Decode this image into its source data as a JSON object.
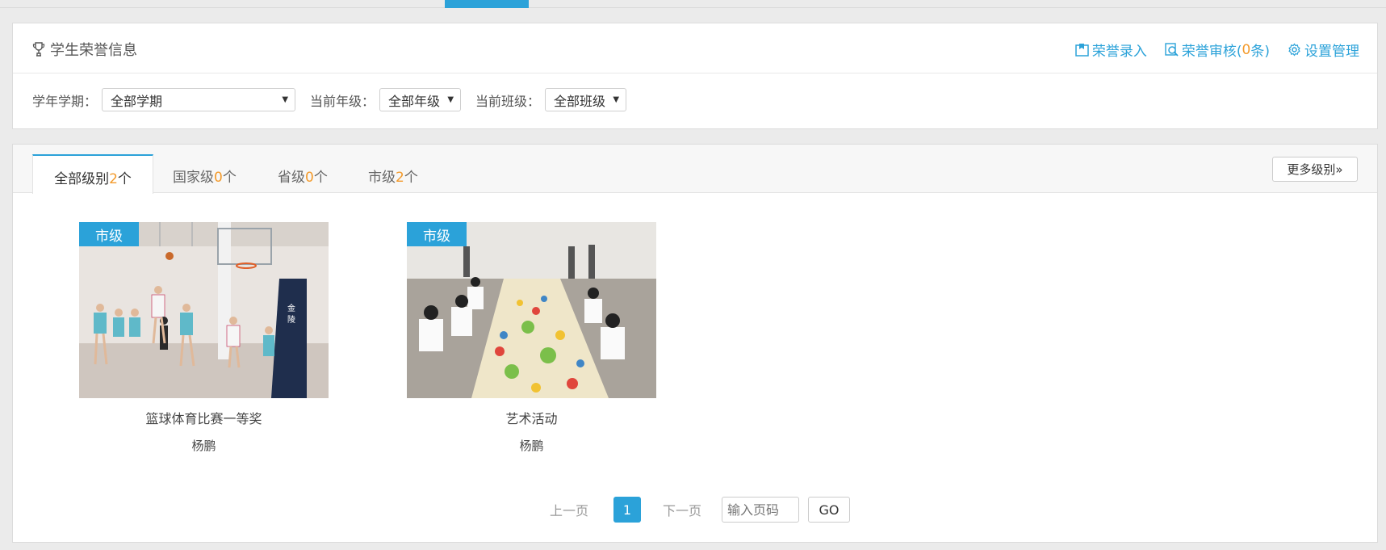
{
  "header": {
    "title": "学生荣誉信息",
    "actions": {
      "entry": "荣誉录入",
      "review_prefix": "荣誉审核(",
      "review_count": "0",
      "review_suffix": "条)",
      "settings": "设置管理"
    }
  },
  "filters": {
    "term_label": "学年学期：",
    "term_value": "全部学期",
    "grade_label": "当前年级：",
    "grade_value": "全部年级",
    "class_label": "当前班级：",
    "class_value": "全部班级"
  },
  "tabs": [
    {
      "label": "全部级别",
      "count": "2",
      "unit": "个"
    },
    {
      "label": "国家级",
      "count": "0",
      "unit": "个"
    },
    {
      "label": "省级",
      "count": "0",
      "unit": "个"
    },
    {
      "label": "市级",
      "count": "2",
      "unit": "个"
    }
  ],
  "more_levels": "更多级别»",
  "cards": [
    {
      "badge": "市级",
      "title": "篮球体育比赛一等奖",
      "student": "杨鹏"
    },
    {
      "badge": "市级",
      "title": "艺术活动",
      "student": "杨鹏"
    }
  ],
  "pagination": {
    "prev": "上一页",
    "current": "1",
    "next": "下一页",
    "input_placeholder": "输入页码",
    "go": "GO"
  },
  "colors": {
    "accent": "#2ba2d9",
    "count": "#f39a2b"
  }
}
